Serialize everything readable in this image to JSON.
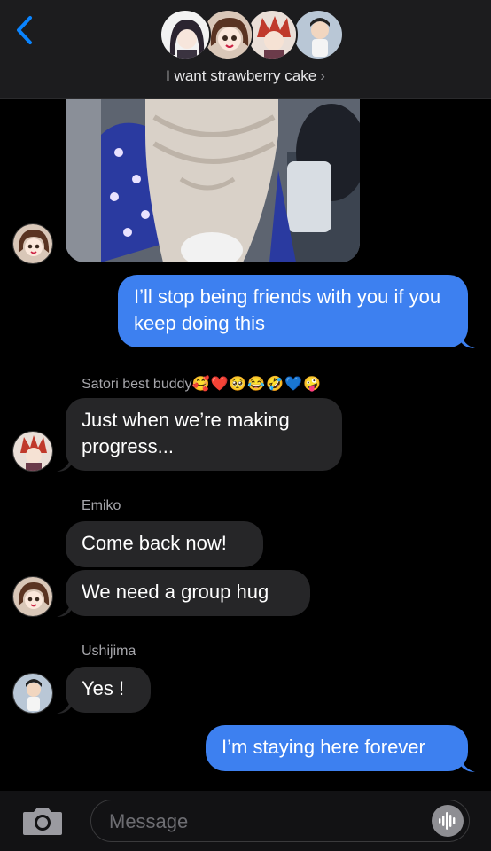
{
  "header": {
    "group_name": "I want strawberry cake",
    "chevron": "›",
    "back_icon": "chevron-left-icon",
    "accent": "#0a84ff"
  },
  "messages": [
    {
      "id": "m1",
      "type": "image",
      "direction": "incoming",
      "description_icon": "photo"
    },
    {
      "id": "m2",
      "direction": "outgoing",
      "text": "I’ll stop being friends with you if you keep doing this"
    },
    {
      "id": "m3",
      "direction": "incoming",
      "sender": "Satori best buddy",
      "sender_emojis": "🥰❤️🥺😂🤣💙🤪",
      "text": "Just when we’re making progress..."
    },
    {
      "id": "m4",
      "direction": "incoming",
      "sender": "Emiko",
      "text": "Come back now!"
    },
    {
      "id": "m5",
      "direction": "incoming",
      "text": "We need a group hug"
    },
    {
      "id": "m6",
      "direction": "incoming",
      "sender": "Ushijima",
      "text": "Yes !"
    },
    {
      "id": "m7",
      "direction": "outgoing",
      "text": "I’m staying here forever"
    }
  ],
  "input": {
    "placeholder": "Message",
    "value": ""
  },
  "colors": {
    "outgoing_bubble": "#3d80f0",
    "incoming_bubble": "#262628",
    "header_bg": "#1c1c1e",
    "background": "#000000"
  }
}
